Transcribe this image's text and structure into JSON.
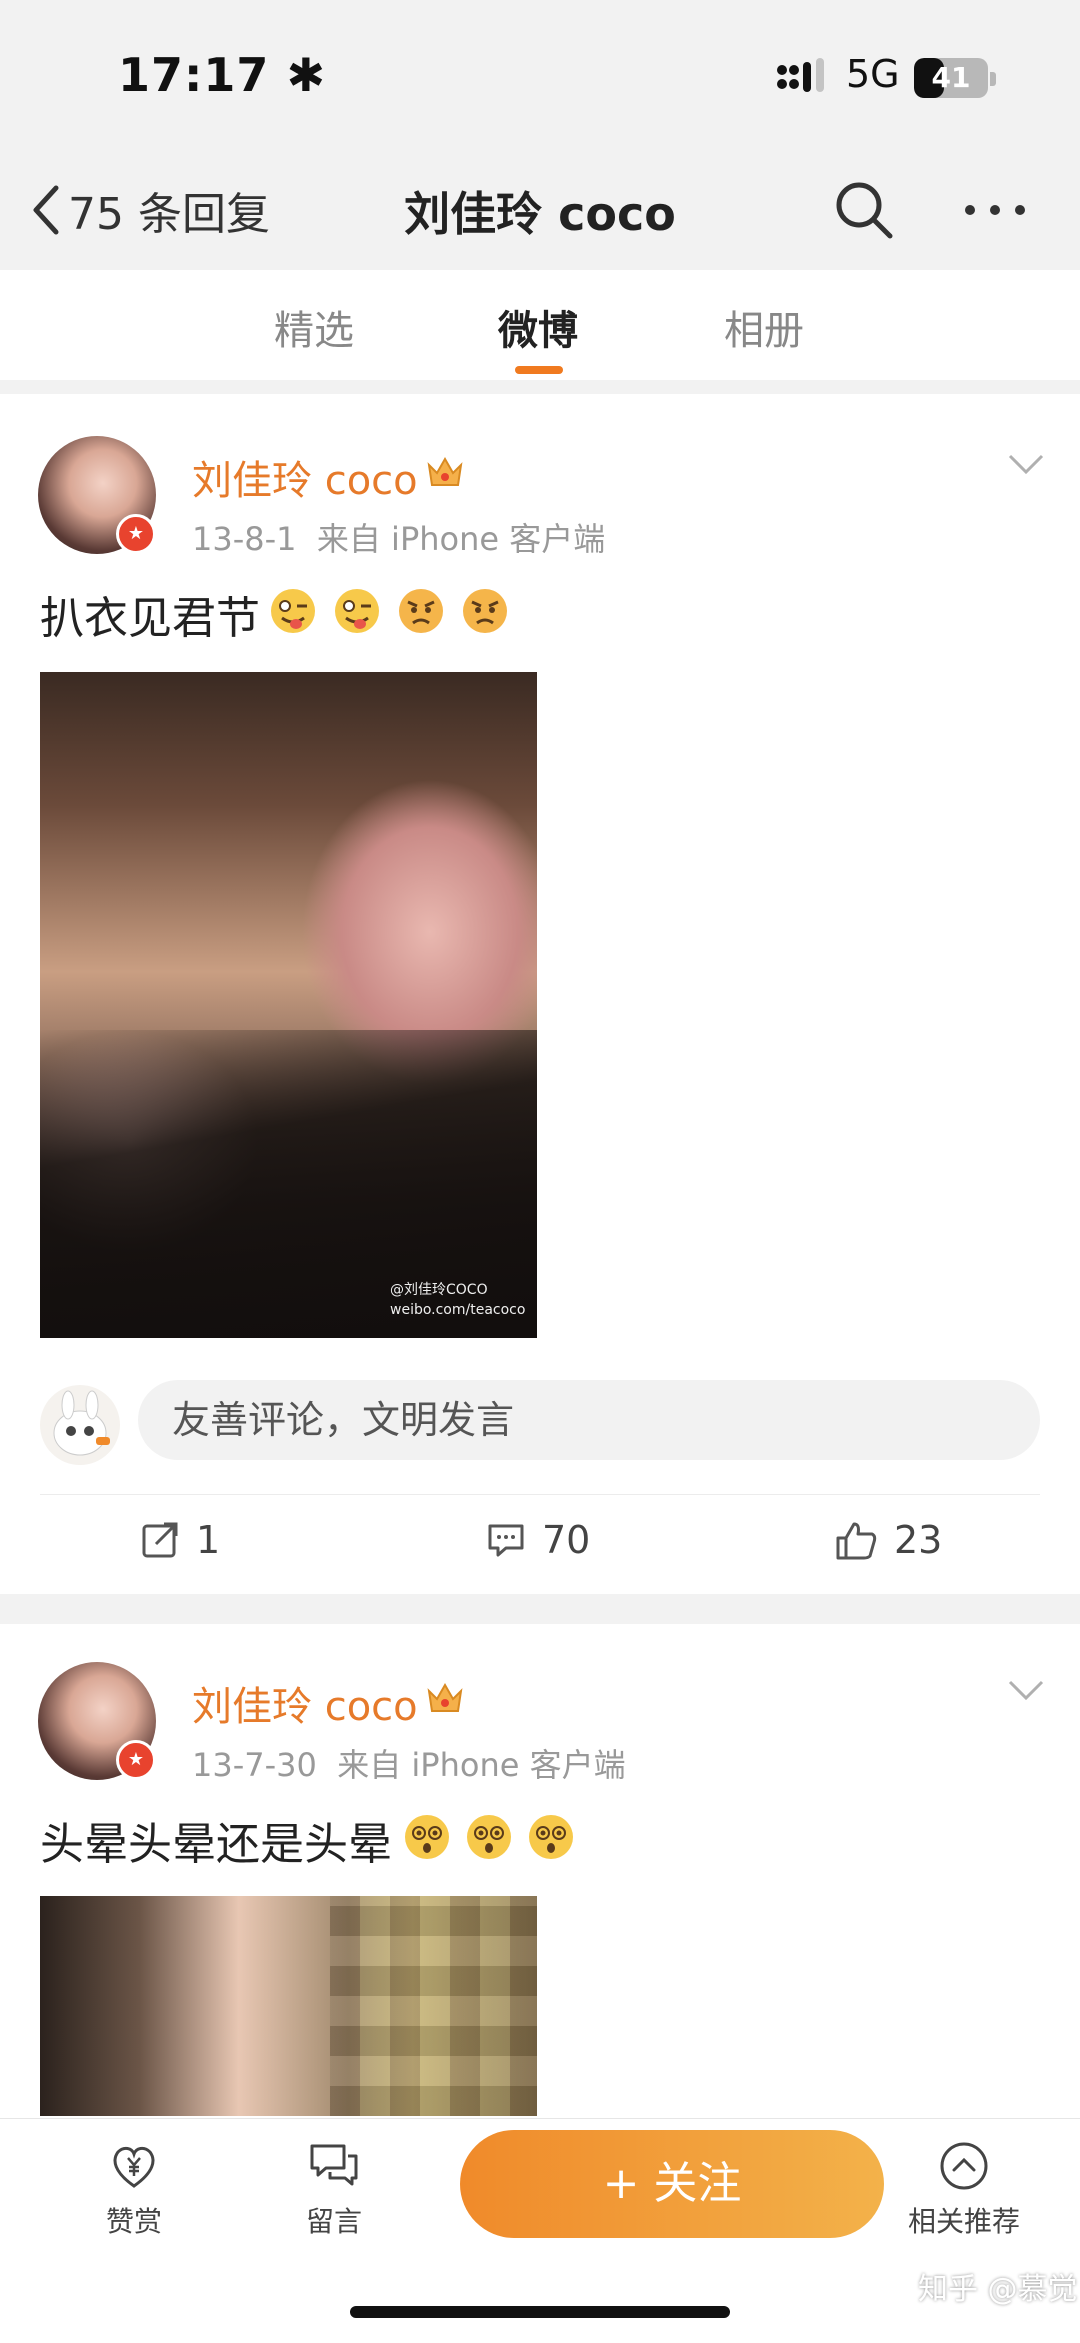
{
  "status": {
    "time": "17:17",
    "time_glyph": "✱",
    "network": "5G",
    "battery": "41",
    "battery_fraction": 0.41
  },
  "nav": {
    "back_label": "75 条回复",
    "title": "刘佳玲 coco"
  },
  "tabs": [
    {
      "label": "精选"
    },
    {
      "label": "微博"
    },
    {
      "label": "相册"
    }
  ],
  "active_tab": "微博",
  "posts": [
    {
      "user": "刘佳玲 coco",
      "date": "13-8-1",
      "source": "来自 iPhone 客户端",
      "text": "扒衣见君节",
      "emojis": [
        "tongue-wink",
        "tongue-wink",
        "angry",
        "angry"
      ],
      "watermark": [
        "@刘佳玲COCO",
        "weibo.com/teacoco"
      ]
    },
    {
      "user": "刘佳玲 coco",
      "date": "13-7-30",
      "source": "来自 iPhone 客户端",
      "text": "头晕头晕还是头晕",
      "emojis": [
        "dizzy",
        "dizzy",
        "dizzy"
      ]
    }
  ],
  "comment_box": {
    "placeholder": "友善评论，文明发言"
  },
  "actions": {
    "repost": "1",
    "comment": "70",
    "like": "23"
  },
  "bottom": {
    "tip": "赞赏",
    "message": "留言",
    "follow": "+ 关注",
    "related": "相关推荐"
  },
  "credit": "知乎 @慕觉",
  "colors": {
    "accent": "#f07a1f",
    "username": "#e67a2a",
    "badge": "#e8432e"
  }
}
